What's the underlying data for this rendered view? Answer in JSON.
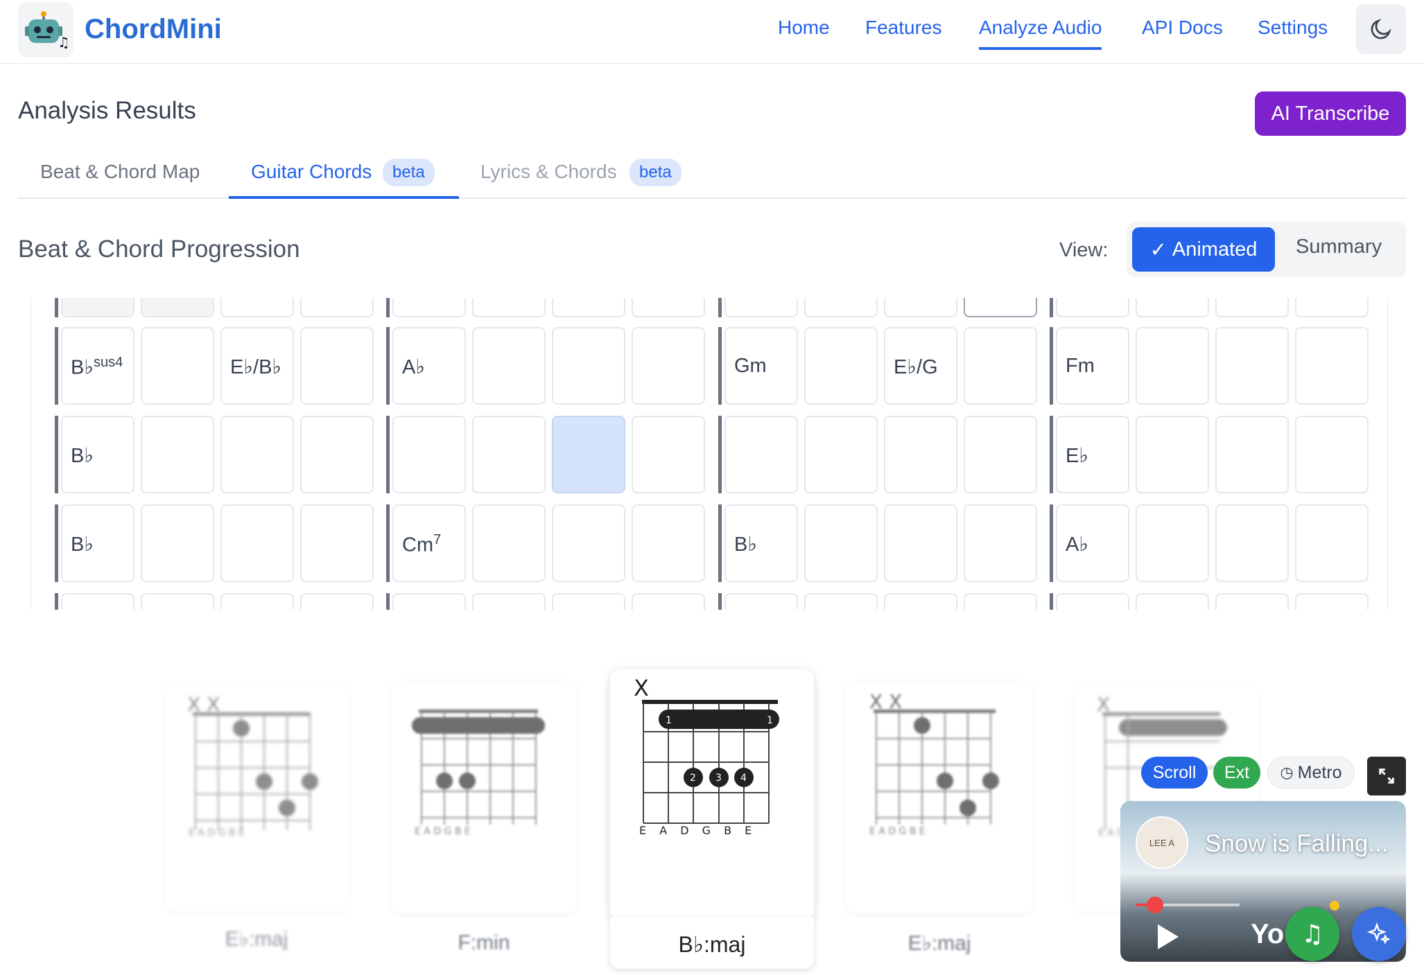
{
  "header": {
    "brand": "ChordMini",
    "nav": [
      "Home",
      "Features",
      "Analyze Audio",
      "API Docs",
      "Settings"
    ],
    "active_nav": "Analyze Audio"
  },
  "analysis": {
    "title": "Analysis Results",
    "ai_button": "AI Transcribe",
    "tabs": [
      {
        "label": "Beat & Chord Map",
        "badge": ""
      },
      {
        "label": "Guitar Chords",
        "badge": "beta"
      },
      {
        "label": "Lyrics & Chords",
        "badge": "beta"
      }
    ],
    "active_tab": "Guitar Chords"
  },
  "progression": {
    "title": "Beat & Chord Progression",
    "view_label": "View:",
    "view_animated": "Animated",
    "view_summary": "Summary",
    "rows": [
      [
        "B♭",
        "",
        "E♭/B♭",
        "",
        "A♭",
        "",
        "",
        "",
        "Gm",
        "",
        "E♭/G",
        "",
        "Fm",
        "",
        "",
        ""
      ],
      [
        "B♭",
        "",
        "",
        "",
        "",
        "",
        "",
        "",
        "",
        "",
        "",
        "",
        "E♭",
        "",
        "",
        ""
      ],
      [
        "B♭",
        "",
        "",
        "",
        "Cm",
        "",
        "",
        "",
        "B♭",
        "",
        "",
        "",
        "A♭",
        "",
        "",
        ""
      ]
    ],
    "sus_label": "sus4",
    "seventh_label": "7",
    "highlighted_cell": {
      "row": 1,
      "col": 6
    }
  },
  "chord_cards": [
    {
      "name": "E♭:maj",
      "muted": "X X",
      "strings": "E A D G B E"
    },
    {
      "name": "F:min",
      "muted": "",
      "strings": "E A D G B E"
    },
    {
      "name": "B♭:maj",
      "muted": "X",
      "strings": "E A D G B E"
    },
    {
      "name": "E♭:maj",
      "muted": "X X",
      "strings": "E A D G B E"
    },
    {
      "name": "",
      "muted": "X",
      "strings": "E A D G B E"
    }
  ],
  "player": {
    "pills": [
      "Scroll",
      "Ext",
      "Metro"
    ],
    "pill_colors": [
      "#2563eb",
      "#2fa84f",
      "#f3f4f6"
    ],
    "video_title": "Snow is Falling...",
    "channel": "LEE A",
    "yt_text": "You"
  },
  "colors": {
    "primary": "#2563eb",
    "ai_purple": "#7e22ce",
    "highlight": "#d6e4fb"
  }
}
